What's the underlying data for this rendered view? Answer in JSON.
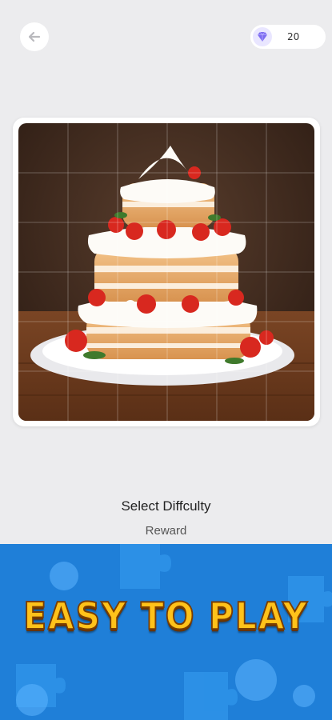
{
  "header": {
    "back_icon": "arrow-left-icon",
    "gem_icon": "diamond-icon",
    "gem_count": "20"
  },
  "puzzle": {
    "subject": "strawberry-cream-cake"
  },
  "difficulty": {
    "title": "Select Diffculty",
    "current_partial": "Reward"
  },
  "promo": {
    "headline": "EASY TO PLAY"
  },
  "colors": {
    "background": "#ececee",
    "banner_blue": "#1f7fd8",
    "headline_yellow": "#ffc21a",
    "gem_purple": "#7d6cf0"
  }
}
